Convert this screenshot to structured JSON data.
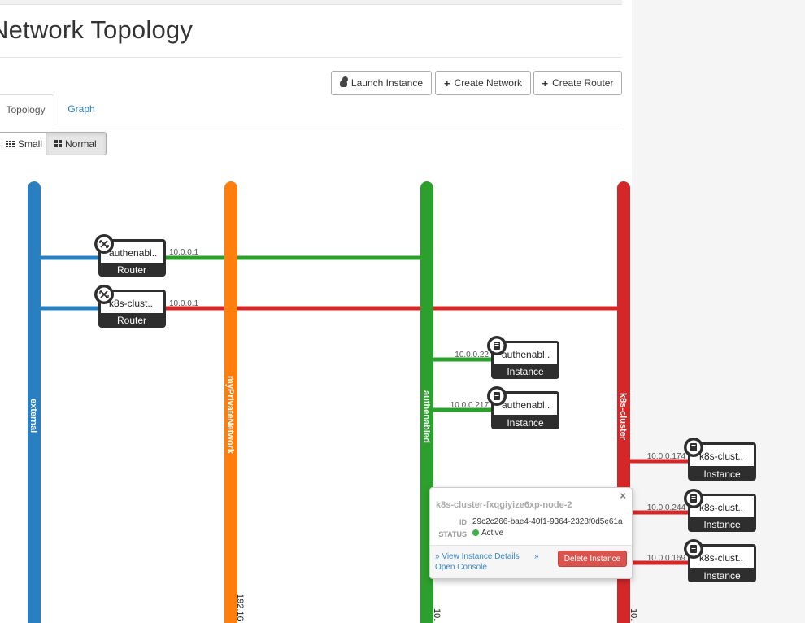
{
  "page": {
    "title": "Network Topology"
  },
  "toolbar": {
    "launch_instance": "Launch Instance",
    "create_network": "Create Network",
    "create_router": "Create Router",
    "create_prefix": "+"
  },
  "tabs": [
    {
      "label": "Topology",
      "active": true
    },
    {
      "label": "Graph",
      "active": false
    }
  ],
  "size_toggle": {
    "small": "Small",
    "normal": "Normal",
    "selected": "Normal"
  },
  "networks": [
    {
      "name": "external",
      "color": "#2a7fc1",
      "cidr": ""
    },
    {
      "name": "myPrivateNetwork",
      "color": "#ff7f0e",
      "cidr": "192.16"
    },
    {
      "name": "authenabled",
      "color": "#2ca02c",
      "cidr": "10."
    },
    {
      "name": "k8s-cluster",
      "color": "#d62728",
      "cidr": "10."
    }
  ],
  "routers": [
    {
      "name": "authenabl..",
      "type": "Router",
      "ip": "10.0.0.1",
      "icon": "router-icon"
    },
    {
      "name": "k8s-clust..",
      "type": "Router",
      "ip": "10.0.0.1",
      "icon": "router-icon"
    }
  ],
  "instances": [
    {
      "name": "authenabl..",
      "type": "Instance",
      "ip": "10.0.0.22",
      "icon": "server-icon"
    },
    {
      "name": "authenabl..",
      "type": "Instance",
      "ip": "10.0.0.217",
      "icon": "server-icon"
    },
    {
      "name": "k8s-clust..",
      "type": "Instance",
      "ip": "10.0.0.174",
      "icon": "server-icon"
    },
    {
      "name": "k8s-clust..",
      "type": "Instance",
      "ip": "10.0.0.244",
      "icon": "server-icon"
    },
    {
      "name": "k8s-clust..",
      "type": "Instance",
      "ip": "10.0.0.169",
      "icon": "server-icon"
    }
  ],
  "popup": {
    "title": "k8s-cluster-fxqgiyize6xp-node-2",
    "close": "×",
    "id_label": "ID",
    "id_value": "29c2c266-bae4-40f1-9364-2328f0d5e61a",
    "status_label": "STATUS",
    "status_value": "Active",
    "status_color": "#3cb34a",
    "view_details": "» View Instance Details",
    "console_prefix": "»",
    "open_console": "Open Console",
    "delete": "Delete Instance"
  },
  "colors": {
    "primary_link": "#2a7ebf",
    "danger": "#d9534f",
    "node_dark": "#2e2e2e"
  }
}
